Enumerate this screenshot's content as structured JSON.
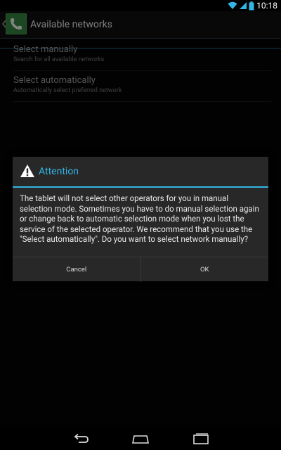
{
  "status_bar": {
    "time": "10:18",
    "icons": [
      "wifi-icon",
      "signal-icon",
      "battery-icon"
    ]
  },
  "action_bar": {
    "title": "Available networks",
    "app_icon": "phone-icon",
    "back_icon": "back-caret-icon"
  },
  "list": {
    "items": [
      {
        "title": "Select manually",
        "subtitle": "Search for all available networks"
      },
      {
        "title": "Select automatically",
        "subtitle": "Automatically select preferred network"
      }
    ]
  },
  "dialog": {
    "icon": "warning-icon",
    "title": "Attention",
    "message": "The tablet will not select other operators for you in manual selection mode. Sometimes you have to do manual selection again or change back to automatic selection mode when you lost the service of the selected operator. We recommend that you use the \"Select automatically\". Do you want to select network manually?",
    "cancel_label": "Cancel",
    "ok_label": "OK"
  },
  "nav_bar": {
    "icons": [
      "back-icon",
      "home-icon",
      "recents-icon"
    ]
  },
  "colors": {
    "accent": "#33b5e5",
    "app_icon_bg": "#35803e",
    "dialog_bg": "#282828"
  }
}
